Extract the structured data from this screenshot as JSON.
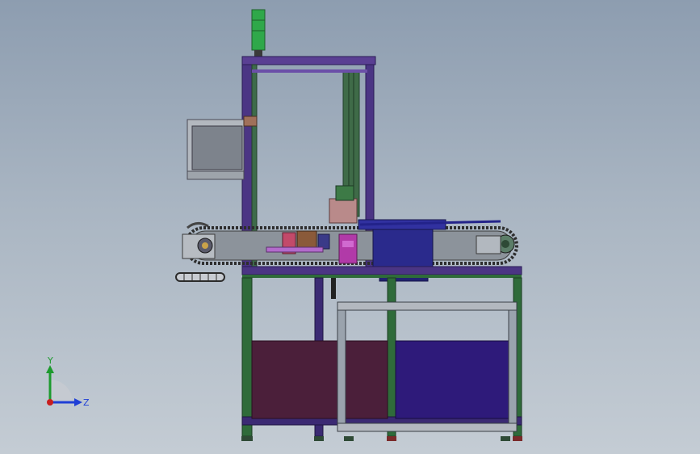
{
  "triad": {
    "y_label": "Y",
    "z_label": "Z",
    "colors": {
      "y": "#1d9a2e",
      "z": "#1f3fd6",
      "x": "#c81e1e"
    }
  },
  "palette": {
    "frame_purple": "#3b2a73",
    "frame_green": "#2f6b3a",
    "maroon_panel": "#4b1f3a",
    "violet_panel": "#2e1a7a",
    "hopper_blue": "#2a2a8c",
    "signal_light": "#2fa84a",
    "conveyor_dark": "#3a3a3a",
    "steel": "#9aa3ad"
  }
}
